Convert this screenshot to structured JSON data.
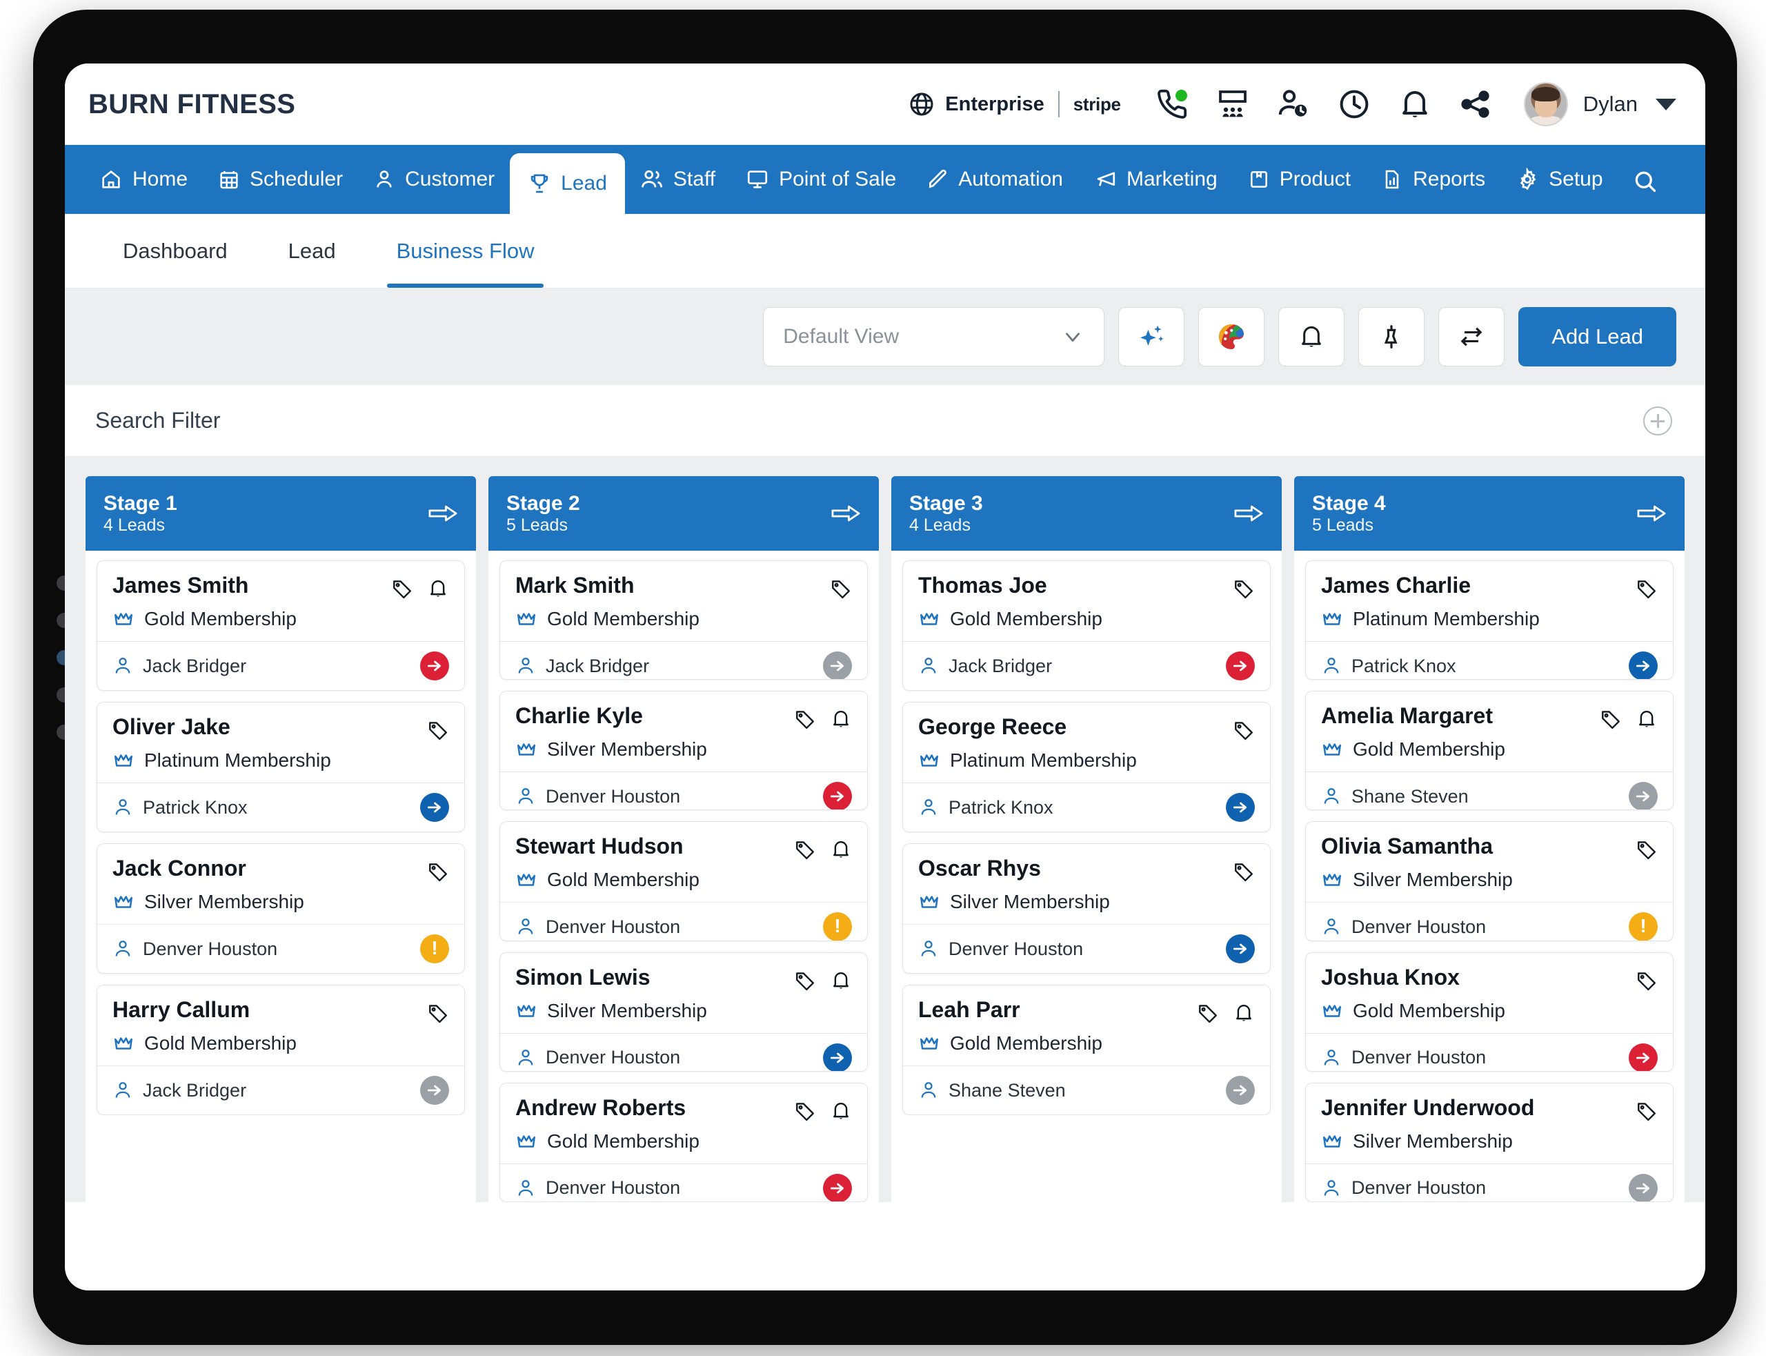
{
  "header": {
    "brand": "BURN FITNESS",
    "enterprise_label": "Enterprise",
    "stripe_label": "stripe",
    "user_name": "Dylan",
    "icons": [
      "globe-icon",
      "phone-icon",
      "presentation-icon",
      "user-clock-icon",
      "clock-icon",
      "bell-icon",
      "share-icon"
    ]
  },
  "main_nav": {
    "items": [
      {
        "label": "Home",
        "icon": "home-icon",
        "active": false
      },
      {
        "label": "Scheduler",
        "icon": "calendar-icon",
        "active": false
      },
      {
        "label": "Customer",
        "icon": "user-icon",
        "active": false
      },
      {
        "label": "Lead",
        "icon": "trophy-icon",
        "active": true
      },
      {
        "label": "Staff",
        "icon": "users-icon",
        "active": false
      },
      {
        "label": "Point of Sale",
        "icon": "monitor-icon",
        "active": false
      },
      {
        "label": "Automation",
        "icon": "pen-icon",
        "active": false
      },
      {
        "label": "Marketing",
        "icon": "megaphone-icon",
        "active": false
      },
      {
        "label": "Product",
        "icon": "box-icon",
        "active": false
      },
      {
        "label": "Reports",
        "icon": "report-icon",
        "active": false
      },
      {
        "label": "Setup",
        "icon": "gear-icon",
        "active": false
      }
    ],
    "search_icon": "search-icon"
  },
  "sub_tabs": [
    {
      "label": "Dashboard",
      "active": false
    },
    {
      "label": "Lead",
      "active": false
    },
    {
      "label": "Business Flow",
      "active": true
    }
  ],
  "toolbar": {
    "view_value": "Default View",
    "view_placeholder": "Default View",
    "buttons": [
      {
        "icon": "sparkle-star-icon",
        "name": "ai-assist-button"
      },
      {
        "icon": "palette-icon",
        "name": "theme-button"
      },
      {
        "icon": "bell-icon",
        "name": "notifications-button"
      },
      {
        "icon": "pin-icon",
        "name": "pin-button"
      },
      {
        "icon": "refresh-icon",
        "name": "refresh-button"
      }
    ],
    "add_lead_label": "Add Lead"
  },
  "search_filter": {
    "label": "Search Filter",
    "add_icon": "plus-circle-icon"
  },
  "colors": {
    "brand_blue": "#1f74c0",
    "status_red": "#dc2036",
    "status_blue": "#0f62b0",
    "status_grey": "#9aa0a6",
    "status_amber": "#f5ad15",
    "online_green": "#1eb81e"
  },
  "board": {
    "columns": [
      {
        "title": "Stage 1",
        "subtitle": "4 Leads",
        "move_icon": "arrow-right-icon",
        "cards": [
          {
            "name": "James Smith",
            "membership": "Gold Membership",
            "owner": "Jack Bridger",
            "has_tag": true,
            "has_bell": true,
            "status": "red"
          },
          {
            "name": "Oliver Jake",
            "membership": "Platinum Membership",
            "owner": "Patrick Knox",
            "has_tag": true,
            "has_bell": false,
            "status": "blue"
          },
          {
            "name": "Jack Connor",
            "membership": "Silver Membership",
            "owner": "Denver Houston",
            "has_tag": true,
            "has_bell": false,
            "status": "amber"
          },
          {
            "name": "Harry Callum",
            "membership": "Gold Membership",
            "owner": "Jack Bridger",
            "has_tag": true,
            "has_bell": false,
            "status": "grey"
          }
        ]
      },
      {
        "title": "Stage 2",
        "subtitle": "5 Leads",
        "move_icon": "arrow-right-icon",
        "cards": [
          {
            "name": "Mark Smith",
            "membership": "Gold Membership",
            "owner": "Jack Bridger",
            "has_tag": true,
            "has_bell": false,
            "status": "grey"
          },
          {
            "name": "Charlie Kyle",
            "membership": "Silver Membership",
            "owner": "Denver Houston",
            "has_tag": true,
            "has_bell": true,
            "status": "red"
          },
          {
            "name": "Stewart Hudson",
            "membership": "Gold Membership",
            "owner": "Denver Houston",
            "has_tag": true,
            "has_bell": true,
            "status": "amber"
          },
          {
            "name": "Simon Lewis",
            "membership": "Silver Membership",
            "owner": "Denver Houston",
            "has_tag": true,
            "has_bell": true,
            "status": "blue"
          },
          {
            "name": "Andrew Roberts",
            "membership": "Gold Membership",
            "owner": "Denver Houston",
            "has_tag": true,
            "has_bell": true,
            "status": "red"
          }
        ]
      },
      {
        "title": "Stage 3",
        "subtitle": "4 Leads",
        "move_icon": "arrow-right-icon",
        "cards": [
          {
            "name": "Thomas Joe",
            "membership": "Gold Membership",
            "owner": "Jack Bridger",
            "has_tag": true,
            "has_bell": false,
            "status": "red"
          },
          {
            "name": "George Reece",
            "membership": "Platinum Membership",
            "owner": "Patrick Knox",
            "has_tag": true,
            "has_bell": false,
            "status": "blue"
          },
          {
            "name": "Oscar Rhys",
            "membership": "Silver Membership",
            "owner": "Denver Houston",
            "has_tag": true,
            "has_bell": false,
            "status": "blue"
          },
          {
            "name": "Leah Parr",
            "membership": "Gold Membership",
            "owner": "Shane Steven",
            "has_tag": true,
            "has_bell": true,
            "status": "grey"
          }
        ]
      },
      {
        "title": "Stage 4",
        "subtitle": "5 Leads",
        "move_icon": "arrow-right-icon",
        "cards": [
          {
            "name": "James Charlie",
            "membership": "Platinum Membership",
            "owner": "Patrick Knox",
            "has_tag": true,
            "has_bell": false,
            "status": "blue"
          },
          {
            "name": "Amelia Margaret",
            "membership": "Gold Membership",
            "owner": "Shane Steven",
            "has_tag": true,
            "has_bell": true,
            "status": "grey"
          },
          {
            "name": "Olivia Samantha",
            "membership": "Silver Membership",
            "owner": "Denver Houston",
            "has_tag": true,
            "has_bell": false,
            "status": "amber"
          },
          {
            "name": "Joshua Knox",
            "membership": "Gold Membership",
            "owner": "Denver Houston",
            "has_tag": true,
            "has_bell": false,
            "status": "red"
          },
          {
            "name": "Jennifer Underwood",
            "membership": "Silver Membership",
            "owner": "Denver Houston",
            "has_tag": true,
            "has_bell": false,
            "status": "grey"
          }
        ]
      }
    ]
  }
}
